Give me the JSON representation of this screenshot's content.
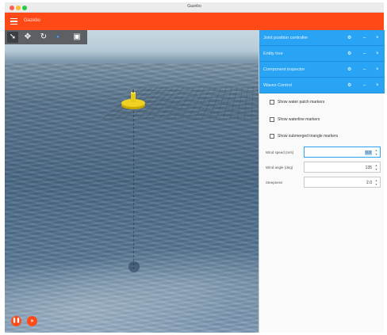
{
  "window": {
    "title": "Gazebo"
  },
  "app_bar": {
    "title": "Gazebo",
    "menu_icon": "hamburger-menu-icon",
    "accent": "#ff4a17"
  },
  "toolbar": {
    "tools": [
      {
        "name": "select-arrow-icon",
        "glyph": "➘"
      },
      {
        "name": "translate-icon",
        "glyph": "✥"
      },
      {
        "name": "rotate-icon",
        "glyph": "↻"
      },
      {
        "name": "light-icon",
        "glyph": "●"
      },
      {
        "name": "screenshot-icon",
        "glyph": "▣"
      }
    ]
  },
  "plugins": [
    {
      "title": "Joint position controller"
    },
    {
      "title": "Entity tree"
    },
    {
      "title": "Component inspector"
    },
    {
      "title": "Waves Control"
    }
  ],
  "plugin_icons": {
    "settings": "⚙",
    "minimize": "–",
    "close": "×"
  },
  "waves_control": {
    "checkboxes": [
      {
        "label": "Show water patch markers",
        "checked": false
      },
      {
        "label": "Show waterline markers",
        "checked": false
      },
      {
        "label": "Show submerged triangle markers",
        "checked": false
      }
    ],
    "params": [
      {
        "label": "Wind speed (m/s)",
        "value": "0.0"
      },
      {
        "label": "Wind angle (deg)",
        "value": "135"
      },
      {
        "label": "Steepness",
        "value": "2.0"
      }
    ]
  },
  "spin": {
    "up": "▲",
    "down": "▼"
  },
  "sim_controls": {
    "play": "❚❚",
    "step": "»"
  },
  "stats": {
    "rtf": "",
    "time": "",
    "iterations": ""
  },
  "colors": {
    "panel_header": "#29a3f3",
    "app_bar": "#ff4a17",
    "buoy": "#f0d020"
  }
}
